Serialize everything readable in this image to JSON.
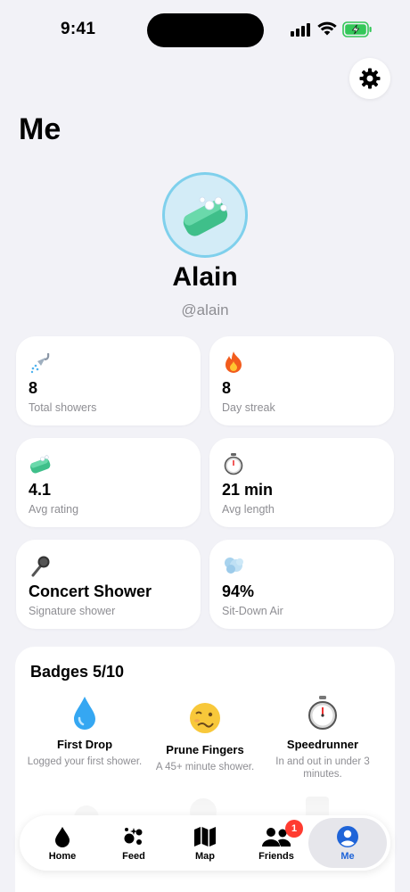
{
  "status_bar": {
    "time": "9:41"
  },
  "header": {
    "title": "Me"
  },
  "profile": {
    "name": "Alain",
    "handle": "@alain"
  },
  "stats": [
    {
      "icon": "shower-icon",
      "value": "8",
      "label": "Total showers"
    },
    {
      "icon": "fire-icon",
      "value": "8",
      "label": "Day streak"
    },
    {
      "icon": "soap-icon",
      "value": "4.1",
      "label": "Avg rating"
    },
    {
      "icon": "stopwatch-icon",
      "value": "21 min",
      "label": "Avg length"
    },
    {
      "icon": "microphone-icon",
      "value": "Concert Shower",
      "label": "Signature shower"
    },
    {
      "icon": "wind-icon",
      "value": "94%",
      "label": "Sit-Down Air"
    }
  ],
  "badges": {
    "title": "Badges 5/10",
    "items": [
      {
        "icon": "droplet-icon",
        "name": "First Drop",
        "desc": "Logged your first shower."
      },
      {
        "icon": "woozy-face-icon",
        "name": "Prune Fingers",
        "desc": "A 45+ minute shower."
      },
      {
        "icon": "stopwatch-icon",
        "name": "Speedrunner",
        "desc": "In and out in under 3 minutes."
      }
    ]
  },
  "tabs": [
    {
      "label": "Home",
      "icon": "drop-icon"
    },
    {
      "label": "Feed",
      "icon": "sparkles-icon"
    },
    {
      "label": "Map",
      "icon": "map-icon"
    },
    {
      "label": "Friends",
      "icon": "people-icon",
      "badge": "1"
    },
    {
      "label": "Me",
      "icon": "person-icon",
      "active": true
    }
  ],
  "colors": {
    "accent": "#1f64d8",
    "notification": "#ff3b30",
    "background": "#f2f2f7"
  }
}
